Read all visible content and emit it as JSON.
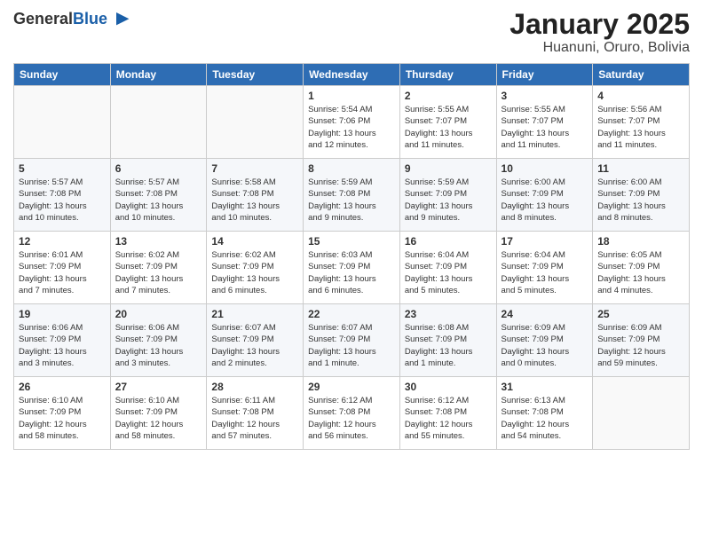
{
  "logo": {
    "general": "General",
    "blue": "Blue"
  },
  "header": {
    "month": "January 2025",
    "location": "Huanuni, Oruro, Bolivia"
  },
  "weekdays": [
    "Sunday",
    "Monday",
    "Tuesday",
    "Wednesday",
    "Thursday",
    "Friday",
    "Saturday"
  ],
  "weeks": [
    [
      {
        "day": "",
        "info": ""
      },
      {
        "day": "",
        "info": ""
      },
      {
        "day": "",
        "info": ""
      },
      {
        "day": "1",
        "info": "Sunrise: 5:54 AM\nSunset: 7:06 PM\nDaylight: 13 hours\nand 12 minutes."
      },
      {
        "day": "2",
        "info": "Sunrise: 5:55 AM\nSunset: 7:07 PM\nDaylight: 13 hours\nand 11 minutes."
      },
      {
        "day": "3",
        "info": "Sunrise: 5:55 AM\nSunset: 7:07 PM\nDaylight: 13 hours\nand 11 minutes."
      },
      {
        "day": "4",
        "info": "Sunrise: 5:56 AM\nSunset: 7:07 PM\nDaylight: 13 hours\nand 11 minutes."
      }
    ],
    [
      {
        "day": "5",
        "info": "Sunrise: 5:57 AM\nSunset: 7:08 PM\nDaylight: 13 hours\nand 10 minutes."
      },
      {
        "day": "6",
        "info": "Sunrise: 5:57 AM\nSunset: 7:08 PM\nDaylight: 13 hours\nand 10 minutes."
      },
      {
        "day": "7",
        "info": "Sunrise: 5:58 AM\nSunset: 7:08 PM\nDaylight: 13 hours\nand 10 minutes."
      },
      {
        "day": "8",
        "info": "Sunrise: 5:59 AM\nSunset: 7:08 PM\nDaylight: 13 hours\nand 9 minutes."
      },
      {
        "day": "9",
        "info": "Sunrise: 5:59 AM\nSunset: 7:09 PM\nDaylight: 13 hours\nand 9 minutes."
      },
      {
        "day": "10",
        "info": "Sunrise: 6:00 AM\nSunset: 7:09 PM\nDaylight: 13 hours\nand 8 minutes."
      },
      {
        "day": "11",
        "info": "Sunrise: 6:00 AM\nSunset: 7:09 PM\nDaylight: 13 hours\nand 8 minutes."
      }
    ],
    [
      {
        "day": "12",
        "info": "Sunrise: 6:01 AM\nSunset: 7:09 PM\nDaylight: 13 hours\nand 7 minutes."
      },
      {
        "day": "13",
        "info": "Sunrise: 6:02 AM\nSunset: 7:09 PM\nDaylight: 13 hours\nand 7 minutes."
      },
      {
        "day": "14",
        "info": "Sunrise: 6:02 AM\nSunset: 7:09 PM\nDaylight: 13 hours\nand 6 minutes."
      },
      {
        "day": "15",
        "info": "Sunrise: 6:03 AM\nSunset: 7:09 PM\nDaylight: 13 hours\nand 6 minutes."
      },
      {
        "day": "16",
        "info": "Sunrise: 6:04 AM\nSunset: 7:09 PM\nDaylight: 13 hours\nand 5 minutes."
      },
      {
        "day": "17",
        "info": "Sunrise: 6:04 AM\nSunset: 7:09 PM\nDaylight: 13 hours\nand 5 minutes."
      },
      {
        "day": "18",
        "info": "Sunrise: 6:05 AM\nSunset: 7:09 PM\nDaylight: 13 hours\nand 4 minutes."
      }
    ],
    [
      {
        "day": "19",
        "info": "Sunrise: 6:06 AM\nSunset: 7:09 PM\nDaylight: 13 hours\nand 3 minutes."
      },
      {
        "day": "20",
        "info": "Sunrise: 6:06 AM\nSunset: 7:09 PM\nDaylight: 13 hours\nand 3 minutes."
      },
      {
        "day": "21",
        "info": "Sunrise: 6:07 AM\nSunset: 7:09 PM\nDaylight: 13 hours\nand 2 minutes."
      },
      {
        "day": "22",
        "info": "Sunrise: 6:07 AM\nSunset: 7:09 PM\nDaylight: 13 hours\nand 1 minute."
      },
      {
        "day": "23",
        "info": "Sunrise: 6:08 AM\nSunset: 7:09 PM\nDaylight: 13 hours\nand 1 minute."
      },
      {
        "day": "24",
        "info": "Sunrise: 6:09 AM\nSunset: 7:09 PM\nDaylight: 13 hours\nand 0 minutes."
      },
      {
        "day": "25",
        "info": "Sunrise: 6:09 AM\nSunset: 7:09 PM\nDaylight: 12 hours\nand 59 minutes."
      }
    ],
    [
      {
        "day": "26",
        "info": "Sunrise: 6:10 AM\nSunset: 7:09 PM\nDaylight: 12 hours\nand 58 minutes."
      },
      {
        "day": "27",
        "info": "Sunrise: 6:10 AM\nSunset: 7:09 PM\nDaylight: 12 hours\nand 58 minutes."
      },
      {
        "day": "28",
        "info": "Sunrise: 6:11 AM\nSunset: 7:08 PM\nDaylight: 12 hours\nand 57 minutes."
      },
      {
        "day": "29",
        "info": "Sunrise: 6:12 AM\nSunset: 7:08 PM\nDaylight: 12 hours\nand 56 minutes."
      },
      {
        "day": "30",
        "info": "Sunrise: 6:12 AM\nSunset: 7:08 PM\nDaylight: 12 hours\nand 55 minutes."
      },
      {
        "day": "31",
        "info": "Sunrise: 6:13 AM\nSunset: 7:08 PM\nDaylight: 12 hours\nand 54 minutes."
      },
      {
        "day": "",
        "info": ""
      }
    ]
  ]
}
